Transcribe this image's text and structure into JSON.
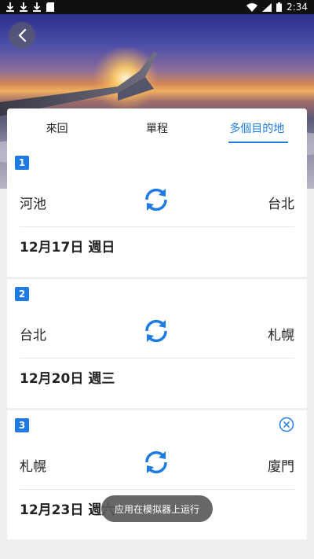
{
  "status_bar": {
    "time": "2:34",
    "left_icons": [
      "download-icon",
      "download-icon",
      "download-icon",
      "sd-card-icon"
    ],
    "right_icons": [
      "wifi-icon",
      "signal-icon",
      "battery-icon"
    ]
  },
  "hero": {
    "image": "airplane-wing-sunset"
  },
  "tabs": [
    {
      "label": "來回"
    },
    {
      "label": "單程"
    },
    {
      "label": "多個目的地",
      "active": true
    }
  ],
  "segments": [
    {
      "number": "1",
      "from": "河池",
      "to": "台北",
      "date": "12月17日",
      "weekday": "週日",
      "removable": false
    },
    {
      "number": "2",
      "from": "台北",
      "to": "札幌",
      "date": "12月20日",
      "weekday": "週三",
      "removable": false
    },
    {
      "number": "3",
      "from": "札幌",
      "to": "廈門",
      "date": "12月23日",
      "weekday": "週六",
      "removable": true
    }
  ],
  "toast": {
    "text": "应用在模拟器上运行"
  },
  "colors": {
    "accent": "#1e7be0",
    "background": "#efeff1"
  }
}
